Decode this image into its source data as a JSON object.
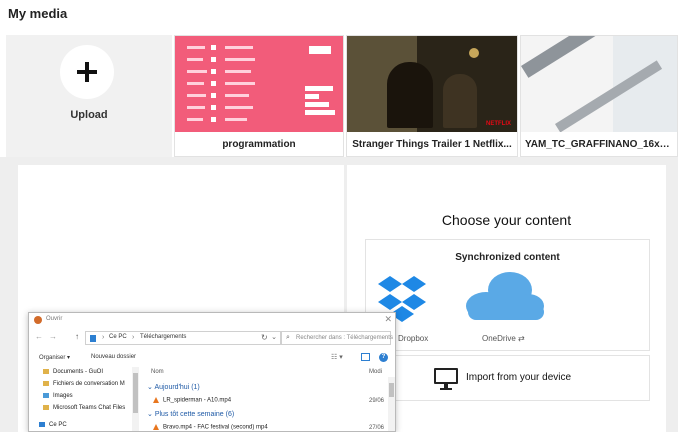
{
  "page": {
    "title": "My media"
  },
  "upload": {
    "label": "Upload"
  },
  "media": [
    {
      "caption": "programmation"
    },
    {
      "caption": "Stranger Things Trailer 1 Netflix..."
    },
    {
      "caption": "YAM_TC_GRAFFINANO_16x9-..."
    }
  ],
  "content_panel": {
    "title": "Choose your content",
    "synchronized_title": "Synchronized content",
    "providers": [
      {
        "label": "Dropbox",
        "icon": "dropbox-icon"
      },
      {
        "label": "OneDrive ⇄",
        "icon": "onedrive-icon"
      }
    ],
    "import_label": "Import from your device"
  },
  "file_dialog": {
    "title": "Ouvrir",
    "breadcrumb": [
      "Ce PC",
      "Téléchargements"
    ],
    "search_placeholder": "Rechercher dans : Téléchargements",
    "toolbar": {
      "organize": "Organiser ▾",
      "new_folder": "Nouveau dossier"
    },
    "sidebar": [
      {
        "label": "Documents - GuOI"
      },
      {
        "label": "Fichiers de conversation M"
      },
      {
        "label": "Images"
      },
      {
        "label": "Microsoft Teams Chat Files"
      },
      {
        "label": "Ce PC"
      }
    ],
    "columns": {
      "name": "Nom",
      "date": "Modi"
    },
    "groups": [
      {
        "label": "Aujourd'hui (1)"
      },
      {
        "label": "Plus tôt cette semaine (6)"
      }
    ],
    "files": [
      {
        "name": "LR_spiderman - A10.mp4",
        "date": "29/06"
      },
      {
        "name": "Bravo.mp4 - FAC festival (second) mp4",
        "date": "27/06"
      }
    ]
  },
  "colors": {
    "accent_blue": "#2d7fd1",
    "dropbox_blue": "#1e88e5",
    "onedrive_blue": "#5aa9e6",
    "thumbnail_pink": "#f25c7a"
  }
}
